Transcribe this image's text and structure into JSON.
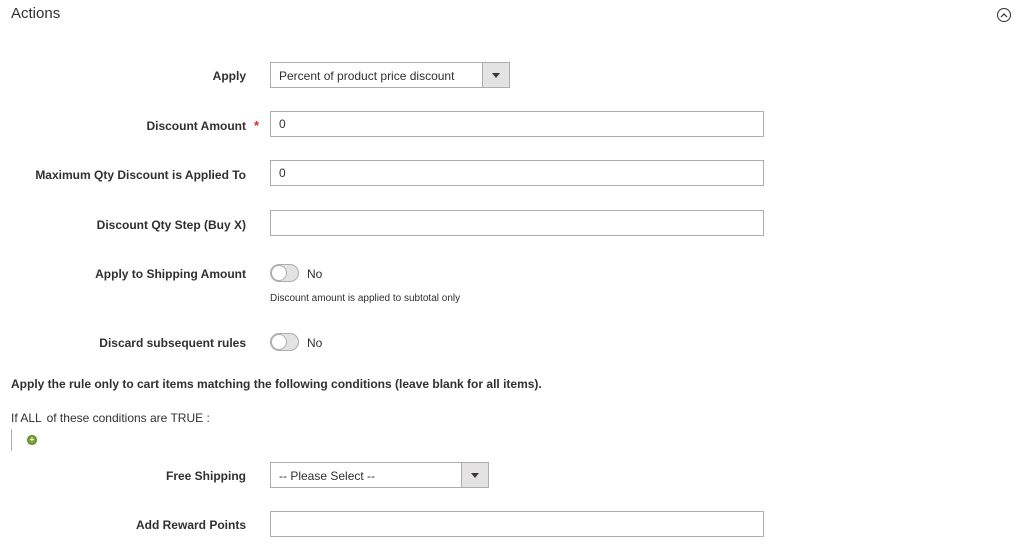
{
  "section": {
    "title": "Actions"
  },
  "fields": {
    "apply": {
      "label": "Apply",
      "value": "Percent of product price discount"
    },
    "discount_amount": {
      "label": "Discount Amount",
      "required_mark": "*",
      "value": "0"
    },
    "max_qty": {
      "label": "Maximum Qty Discount is Applied To",
      "value": "0"
    },
    "discount_step": {
      "label": "Discount Qty Step (Buy X)",
      "value": ""
    },
    "apply_shipping": {
      "label": "Apply to Shipping Amount",
      "state": "No",
      "note": "Discount amount is applied to subtotal only"
    },
    "discard_rules": {
      "label": "Discard subsequent rules",
      "state": "No"
    },
    "free_shipping": {
      "label": "Free Shipping",
      "value": "-- Please Select --"
    },
    "reward_points": {
      "label": "Add Reward Points",
      "value": ""
    }
  },
  "conditions": {
    "heading": "Apply the rule only to cart items matching the following conditions (leave blank for all items).",
    "prefix": "If",
    "aggregator": "ALL",
    "middle": "of these conditions are",
    "value": "TRUE",
    "suffix": ":"
  },
  "icons": {
    "collapse": "chevron-up-circle-icon",
    "add": "add-condition-icon",
    "dropdown": "triangle-down-icon"
  },
  "colors": {
    "required": "#e22626",
    "add_icon": "#79a22e"
  }
}
